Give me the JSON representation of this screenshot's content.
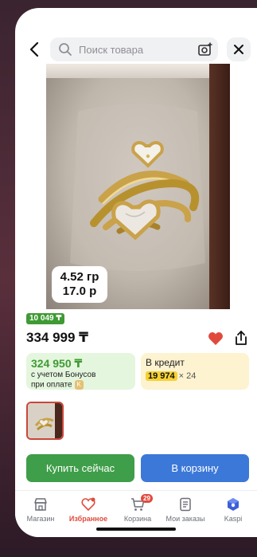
{
  "search": {
    "placeholder": "Поиск товара"
  },
  "product": {
    "weight": "4.52 гр",
    "size": "17.0 р",
    "old_price": "10 049 ₸",
    "price": "334 999 ₸"
  },
  "bonus": {
    "price": "324 950 ₸",
    "line1": "с учетом Бонусов",
    "line2": "при оплате",
    "badge": "K"
  },
  "credit": {
    "title": "В кредит",
    "amount": "19 974",
    "multiplier": "× 24"
  },
  "actions": {
    "buy_now": "Купить сейчас",
    "to_cart": "В корзину"
  },
  "tabs": [
    {
      "label": "Магазин",
      "icon": "store-icon"
    },
    {
      "label": "Избранное",
      "icon": "heart-icon",
      "active": true
    },
    {
      "label": "Корзина",
      "icon": "cart-icon",
      "badge": "29"
    },
    {
      "label": "Мои заказы",
      "icon": "orders-icon"
    },
    {
      "label": "Kaspi",
      "icon": "kaspi-icon"
    }
  ],
  "colors": {
    "green": "#3f9e4a",
    "blue": "#3c78d8",
    "red": "#e04a3c",
    "yellow": "#f6d133"
  }
}
